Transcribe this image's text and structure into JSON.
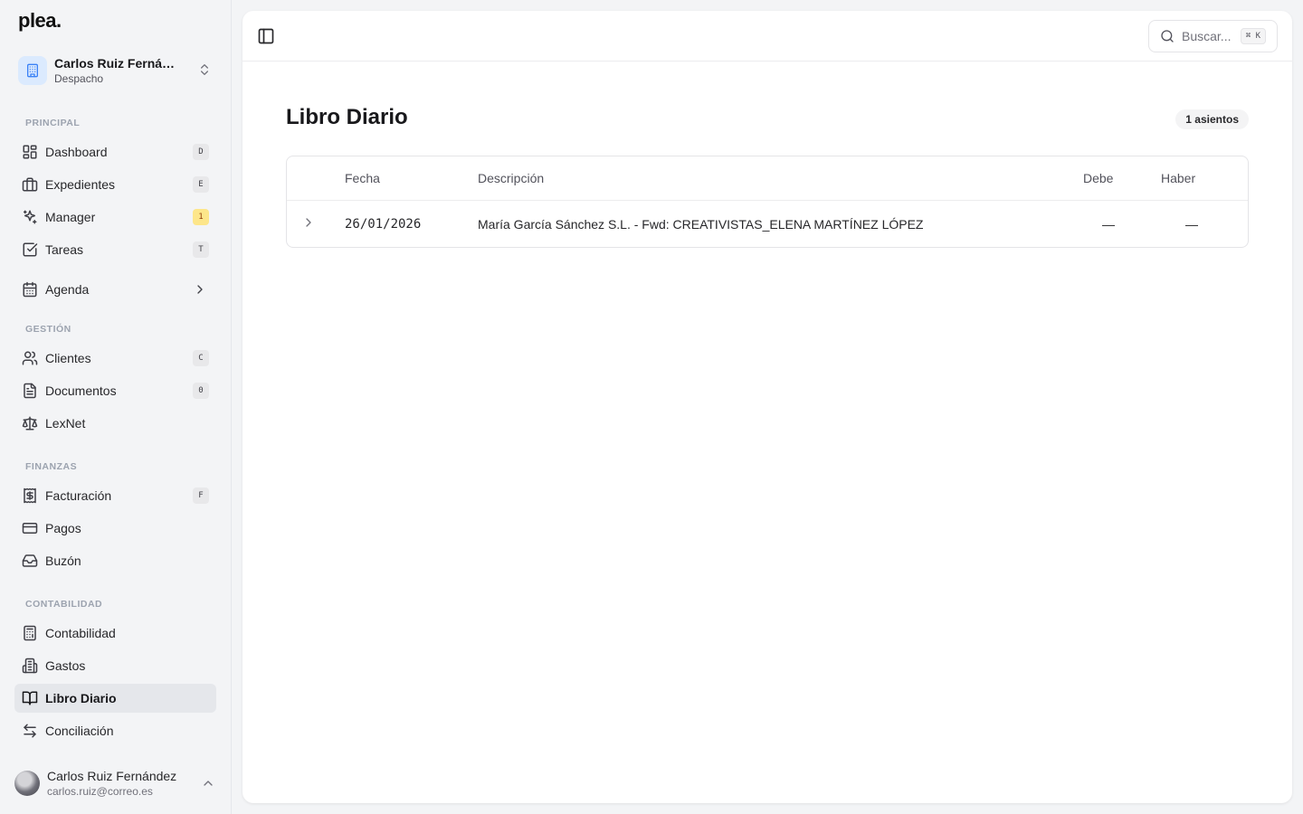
{
  "app": {
    "logo": "plea."
  },
  "workspace": {
    "name": "Carlos Ruiz Fernández",
    "subtitle": "Despacho"
  },
  "sidebar": {
    "sections": {
      "principal": "PRINCIPAL",
      "gestion": "GESTIÓN",
      "finanzas": "FINANZAS",
      "contabilidad": "CONTABILIDAD"
    },
    "items": [
      {
        "label": "Dashboard",
        "shortcut": "D",
        "icon": "layout-grid-icon"
      },
      {
        "label": "Expedientes",
        "shortcut": "E",
        "icon": "briefcase-icon"
      },
      {
        "label": "Manager",
        "shortcut": "1",
        "icon": "sparkles-icon"
      },
      {
        "label": "Tareas",
        "shortcut": "T",
        "icon": "check-square-icon"
      },
      {
        "label": "Agenda",
        "icon": "calendar-icon"
      },
      {
        "label": "Clientes",
        "shortcut": "C",
        "icon": "users-icon"
      },
      {
        "label": "Documentos",
        "shortcut": "0",
        "icon": "file-text-icon"
      },
      {
        "label": "LexNet",
        "icon": "scale-icon"
      },
      {
        "label": "Facturación",
        "shortcut": "F",
        "icon": "receipt-icon"
      },
      {
        "label": "Pagos",
        "icon": "credit-card-icon"
      },
      {
        "label": "Buzón",
        "icon": "inbox-icon"
      },
      {
        "label": "Contabilidad",
        "icon": "calculator-icon"
      },
      {
        "label": "Gastos",
        "icon": "building-icon"
      },
      {
        "label": "Libro Diario",
        "icon": "book-open-icon",
        "active": true
      },
      {
        "label": "Conciliación",
        "icon": "arrow-left-right-icon"
      }
    ]
  },
  "user": {
    "name": "Carlos Ruiz Fernández",
    "email": "carlos.ruiz@correo.es"
  },
  "topbar": {
    "search_placeholder": "Buscar...",
    "search_shortcut": "⌘ K"
  },
  "page": {
    "title": "Libro Diario",
    "count_badge": "1 asientos"
  },
  "table": {
    "columns": {
      "fecha": "Fecha",
      "descripcion": "Descripción",
      "debe": "Debe",
      "haber": "Haber"
    },
    "rows": [
      {
        "fecha": "26/01/2026",
        "descripcion": "María García Sánchez S.L. - Fwd: CREATIVISTAS_ELENA MARTÍNEZ LÓPEZ",
        "debe": "—",
        "haber": "—"
      }
    ]
  },
  "colors": {
    "accent_workspace": "#dbeafe",
    "badge_warn": "#fde68a",
    "active_bg": "#e5e7eb"
  }
}
